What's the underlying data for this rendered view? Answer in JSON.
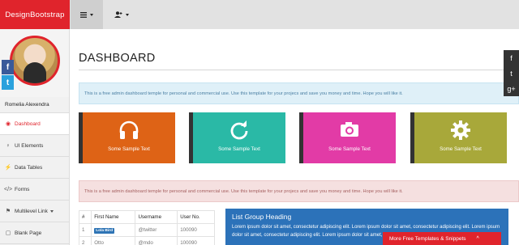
{
  "brand": "DesignBootstrap",
  "topbar": {
    "menu_button": "menu",
    "user_button": "user"
  },
  "sidebar": {
    "username": "Romelia Alexendra",
    "social": {
      "facebook": "f",
      "twitter": "t"
    },
    "items": [
      {
        "label": "Dashboard",
        "icon": "dashboard-icon",
        "glyph": "◉",
        "active": true
      },
      {
        "label": "UI Elements",
        "icon": "lightbulb-icon",
        "glyph": "♀",
        "active": false
      },
      {
        "label": "Data Tables",
        "icon": "table-icon",
        "glyph": "⚡",
        "active": false
      },
      {
        "label": "Forms",
        "icon": "code-icon",
        "glyph": "</>",
        "active": false
      },
      {
        "label": "Multilevel Link",
        "icon": "sitemap-icon",
        "glyph": "⚑",
        "active": false
      },
      {
        "label": "Blank Page",
        "icon": "file-icon",
        "glyph": "▢",
        "active": false
      }
    ]
  },
  "main": {
    "title": "DASHBOARD",
    "info_alert": "This is a free admin dashboard temple for personal and commercial use. Use this template for your projecs and save you money and time. Hope you will like it.",
    "danger_alert": "This is a free admin dashboard temple for personal and commercial use. Use this template for your projecs and save you money and time. Hope you will like it.",
    "tiles": [
      {
        "text": "Some Sample Text",
        "icon": "headphones-icon",
        "color": "#de6316"
      },
      {
        "text": "Some Sample Text",
        "icon": "refresh-icon",
        "color": "#2ab9a6"
      },
      {
        "text": "Some Sample Text",
        "icon": "camera-icon",
        "color": "#e23ba6"
      },
      {
        "text": "Some Sample Text",
        "icon": "gear-icon",
        "color": "#a8a83a"
      }
    ],
    "table": {
      "headers": [
        "#",
        "First Name",
        "Username",
        "User No."
      ],
      "rows": [
        {
          "num": "1",
          "first": "Lola Bird",
          "username": "@twitter",
          "userno": "100090"
        },
        {
          "num": "2",
          "first": "Otto",
          "username": "@mdo",
          "userno": "100090"
        }
      ]
    },
    "list_group": {
      "heading": "List Group Heading",
      "text": "Lorem ipsum dolor sit amet, consectetur adipiscing elit. Lorem ipsum dolor sit amet, consectetur adipiscing elit. Lorem ipsum dolor sit amet, consectetur adipiscing elit. Lorem ipsum dolor sit amet, consectetur adipiscing elit."
    }
  },
  "right_social": {
    "facebook": "f",
    "twitter": "t",
    "google": "g+"
  },
  "promo": {
    "label": "More Free Templates & Snippets",
    "chevron": "^"
  },
  "colors": {
    "brand_red": "#e0242c",
    "list_blue": "#2c72b9"
  }
}
